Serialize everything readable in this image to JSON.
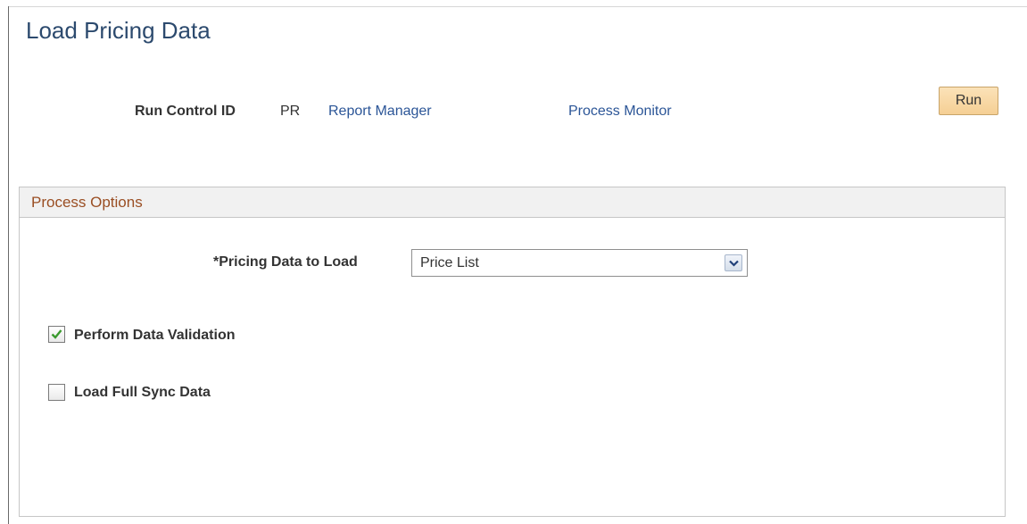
{
  "page": {
    "title": "Load Pricing Data"
  },
  "run_control": {
    "label": "Run Control ID",
    "value": "PR",
    "report_manager_link": "Report Manager",
    "process_monitor_link": "Process Monitor",
    "run_button_label": "Run"
  },
  "process_options": {
    "header": "Process Options",
    "pricing_data": {
      "label": "*Pricing Data to Load",
      "selected": "Price List"
    },
    "perform_validation": {
      "label": "Perform Data Validation",
      "checked": true
    },
    "load_full_sync": {
      "label": "Load Full Sync Data",
      "checked": false
    }
  },
  "colors": {
    "title": "#2c4a6e",
    "link": "#2b5597",
    "group_header_text": "#9a4e23",
    "run_button": "#f5cf94",
    "checkmark": "#3a9a2e"
  },
  "icons": {
    "dropdown": "chevron-down-icon",
    "check": "checkmark-icon"
  }
}
